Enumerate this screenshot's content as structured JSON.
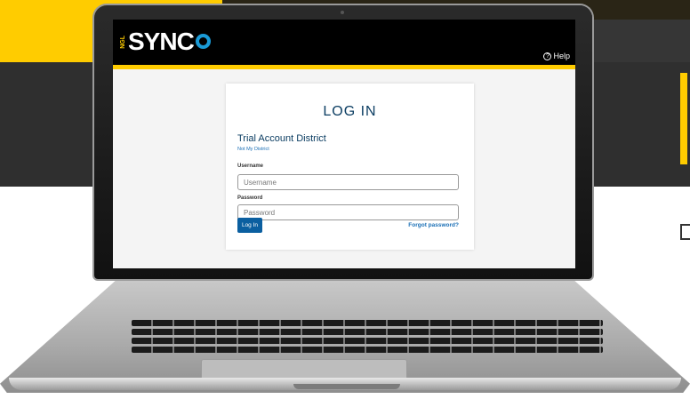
{
  "header": {
    "logo_vertical": "NGL",
    "logo_word": "SYNC",
    "help_label": "Help",
    "help_icon": "question-circle-icon"
  },
  "login": {
    "title": "LOG IN",
    "district_name": "Trial Account District",
    "not_my_district": "Not My District",
    "username_label": "Username",
    "username_placeholder": "Username",
    "password_label": "Password",
    "password_placeholder": "Password",
    "login_button": "Log In",
    "forgot_password": "Forgot password?"
  },
  "colors": {
    "brand_yellow": "#ffcc00",
    "brand_blue": "#0b5fa0",
    "link_blue": "#1a6fb6",
    "title_navy": "#0b3d62"
  }
}
